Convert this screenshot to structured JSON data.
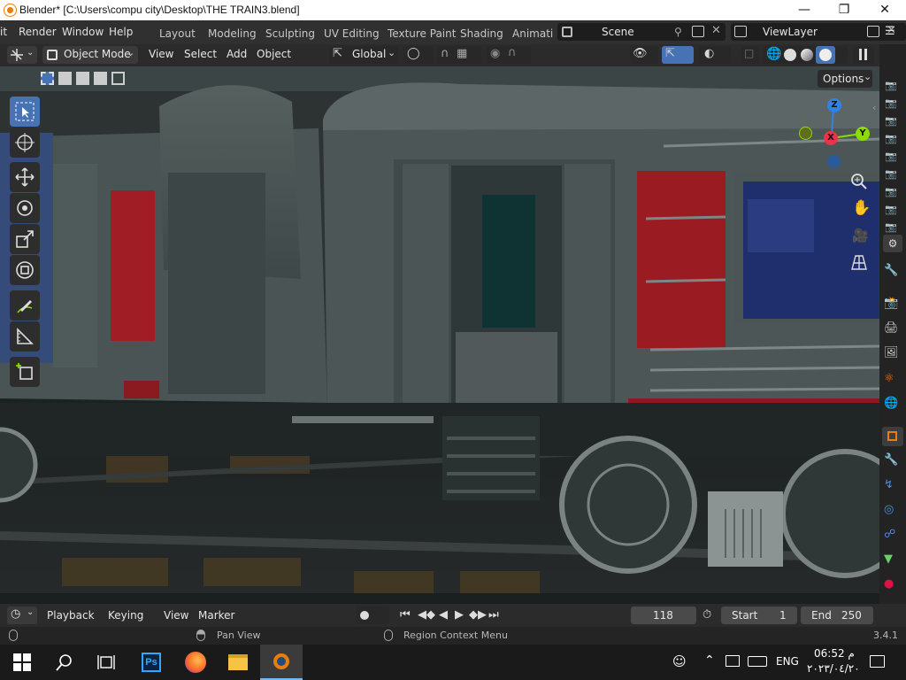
{
  "window": {
    "title": "Blender* [C:\\Users\\compu city\\Desktop\\THE TRAIN3.blend]",
    "minimize": "—",
    "maximize": "❐",
    "close": "✕"
  },
  "menubar": {
    "menus": [
      "it",
      "Render",
      "Window",
      "Help"
    ],
    "workspaces": [
      "Layout",
      "Modeling",
      "Sculpting",
      "UV Editing",
      "Texture Paint",
      "Shading",
      "Animati"
    ],
    "scene": "Scene",
    "view_layer": "ViewLayer"
  },
  "viewport_header": {
    "mode": "Object Mode",
    "menus": [
      "View",
      "Select",
      "Add",
      "Object"
    ],
    "transform_orientation": "Global",
    "options_label": "Options"
  },
  "gizmo": {
    "z": "Z",
    "x": "X",
    "y": "Y"
  },
  "timeline": {
    "menus": [
      "Playback",
      "Keying",
      "View",
      "Marker"
    ],
    "current_frame": "118",
    "start_label": "Start",
    "start": "1",
    "end_label": "End",
    "end": "250"
  },
  "statusbar": {
    "hint1": "Pan View",
    "hint2": "Region Context Menu",
    "version": "3.4.1"
  },
  "taskbar": {
    "language": "ENG",
    "time": "06:52 م",
    "date": "٢٠٢٣/٠٤/٢٠"
  },
  "colors": {
    "accent": "#4772b3",
    "blender_orange": "#e87d0d",
    "axis_x": "#e8334a",
    "axis_y": "#8bdc00",
    "axis_z": "#2f83e3"
  }
}
